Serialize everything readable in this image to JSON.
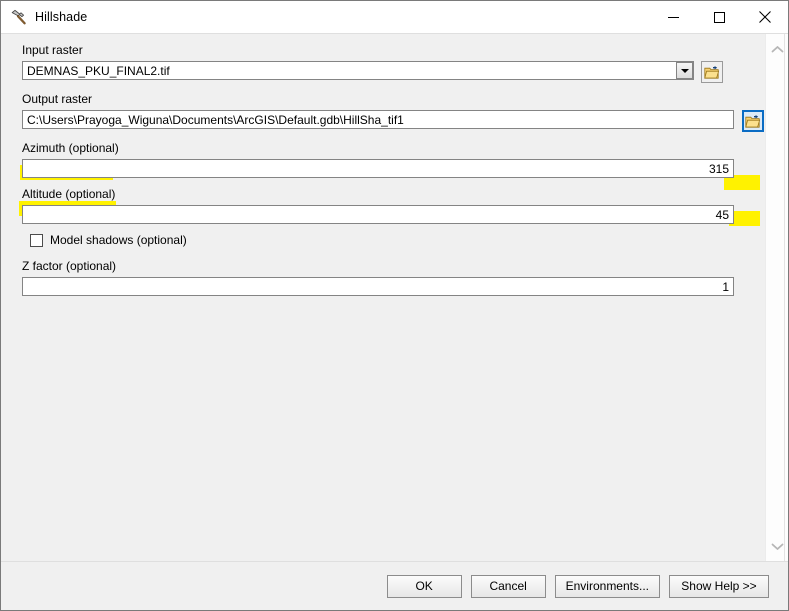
{
  "window": {
    "title": "Hillshade",
    "icon": "hammer-tool-icon",
    "controls": {
      "minimize": "minimize-icon",
      "maximize": "maximize-icon",
      "close": "close-icon"
    }
  },
  "form": {
    "input_raster": {
      "label": "Input raster",
      "value": "DEMNAS_PKU_FINAL2.tif",
      "placeholder": "",
      "dropdown_icon": "chevron-down-icon",
      "browse_icon": "open-folder-icon"
    },
    "output_raster": {
      "label": "Output raster",
      "value": "C:\\Users\\Prayoga_Wiguna\\Documents\\ArcGIS\\Default.gdb\\HillSha_tif1",
      "placeholder": "",
      "browse_icon": "open-folder-icon"
    },
    "azimuth": {
      "label": "Azimuth (optional)",
      "value": "315",
      "placeholder": "",
      "highlighted": true
    },
    "altitude": {
      "label": "Altitude (optional)",
      "value": "45",
      "placeholder": "",
      "highlighted": true
    },
    "model_shadows": {
      "label": "Model shadows (optional)",
      "checked": false
    },
    "z_factor": {
      "label": "Z factor (optional)",
      "value": "1",
      "placeholder": ""
    }
  },
  "scrollbar": {
    "up_arrow": "chevron-up-icon",
    "down_arrow": "chevron-down-icon"
  },
  "buttons": {
    "ok": "OK",
    "cancel": "Cancel",
    "environments": "Environments...",
    "show_help": "Show Help >>"
  },
  "colors": {
    "highlight": "#fff200",
    "dialog_bg": "#f0f0f0",
    "titlebar_bg": "#ffffff",
    "focus_border": "#0a6cc4",
    "folder_icon": "#f4c244"
  }
}
